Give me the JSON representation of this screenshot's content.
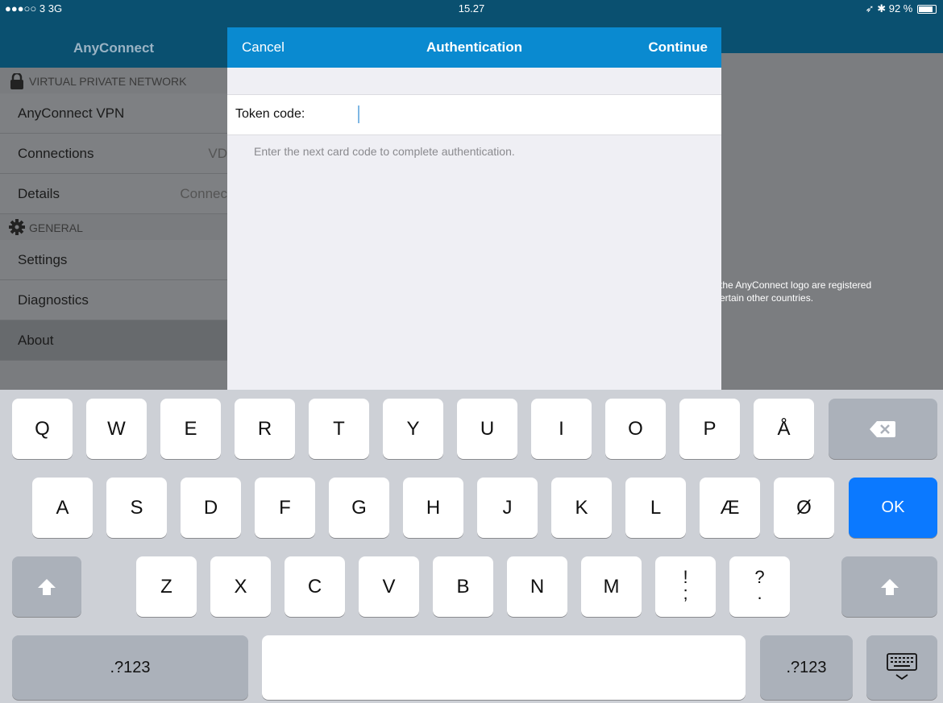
{
  "status": {
    "carrier": "●●●○○ 3  3G",
    "time": "15.27",
    "right": "92 %"
  },
  "app": {
    "title": "AnyConnect",
    "sections": {
      "vpn": "VIRTUAL PRIVATE NETWORK",
      "general": "GENERAL"
    },
    "vpn_items": [
      {
        "label": "AnyConnect VPN",
        "value": ""
      },
      {
        "label": "Connections",
        "value": "VD"
      },
      {
        "label": "Details",
        "value": "Connec"
      }
    ],
    "general_items": [
      {
        "label": "Settings"
      },
      {
        "label": "Diagnostics"
      },
      {
        "label": "About"
      }
    ],
    "legal_line1": "the AnyConnect logo are registered",
    "legal_line2": "ertain other countries."
  },
  "dialog": {
    "cancel": "Cancel",
    "title": "Authentication",
    "continue": "Continue",
    "token_label": "Token code:",
    "token_value": "",
    "hint": "Enter the next card code to complete authentication."
  },
  "keyboard": {
    "row1": [
      "Q",
      "W",
      "E",
      "R",
      "T",
      "Y",
      "U",
      "I",
      "O",
      "P",
      "Å"
    ],
    "row2": [
      "A",
      "S",
      "D",
      "F",
      "G",
      "H",
      "J",
      "K",
      "L",
      "Æ",
      "Ø"
    ],
    "row3": [
      "Z",
      "X",
      "C",
      "V",
      "B",
      "N",
      "M"
    ],
    "punct1": [
      "!",
      ";"
    ],
    "punct2": [
      "?",
      "."
    ],
    "ok": "OK",
    "num1": ".?123",
    "num2": ".?123",
    "icons": {
      "backspace": "backspace-icon",
      "shift": "shift-icon",
      "dismiss": "keyboard-dismiss-icon"
    }
  }
}
